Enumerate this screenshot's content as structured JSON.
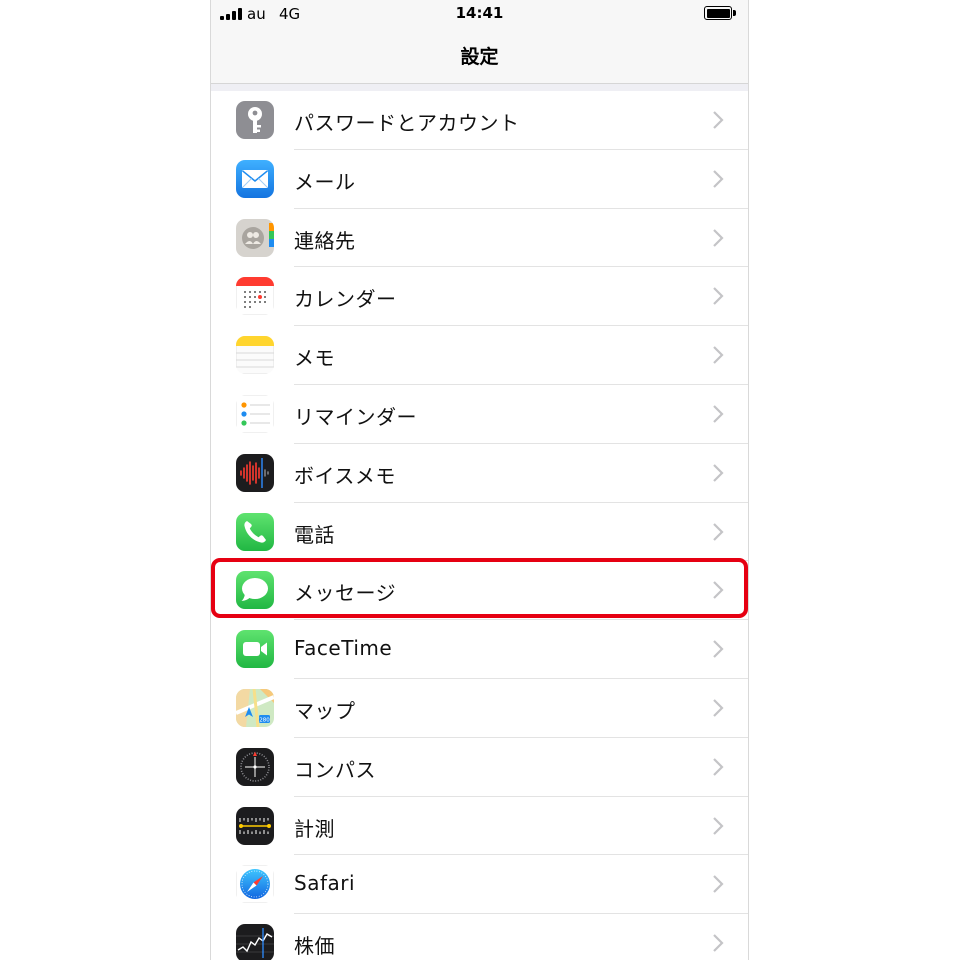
{
  "status_bar": {
    "carrier": "au",
    "network": "4G",
    "time": "14:41"
  },
  "nav": {
    "title": "設定"
  },
  "rows": [
    {
      "label": "パスワードとアカウント",
      "icon": "key-icon"
    },
    {
      "label": "メール",
      "icon": "mail-icon"
    },
    {
      "label": "連絡先",
      "icon": "contacts-icon"
    },
    {
      "label": "カレンダー",
      "icon": "calendar-icon"
    },
    {
      "label": "メモ",
      "icon": "notes-icon"
    },
    {
      "label": "リマインダー",
      "icon": "reminders-icon"
    },
    {
      "label": "ボイスメモ",
      "icon": "voice-memo-icon"
    },
    {
      "label": "電話",
      "icon": "phone-icon"
    },
    {
      "label": "メッセージ",
      "icon": "messages-icon"
    },
    {
      "label": "FaceTime",
      "icon": "facetime-icon"
    },
    {
      "label": "マップ",
      "icon": "maps-icon"
    },
    {
      "label": "コンパス",
      "icon": "compass-icon"
    },
    {
      "label": "計測",
      "icon": "measure-icon"
    },
    {
      "label": "Safari",
      "icon": "safari-icon"
    },
    {
      "label": "株価",
      "icon": "stocks-icon"
    }
  ],
  "highlight": {
    "row_label": "メッセージ",
    "color": "#e60012"
  },
  "colors": {
    "accent_highlight": "#e60012",
    "messages_green": "#34c759",
    "mail_blue": "#1e8cf0"
  }
}
